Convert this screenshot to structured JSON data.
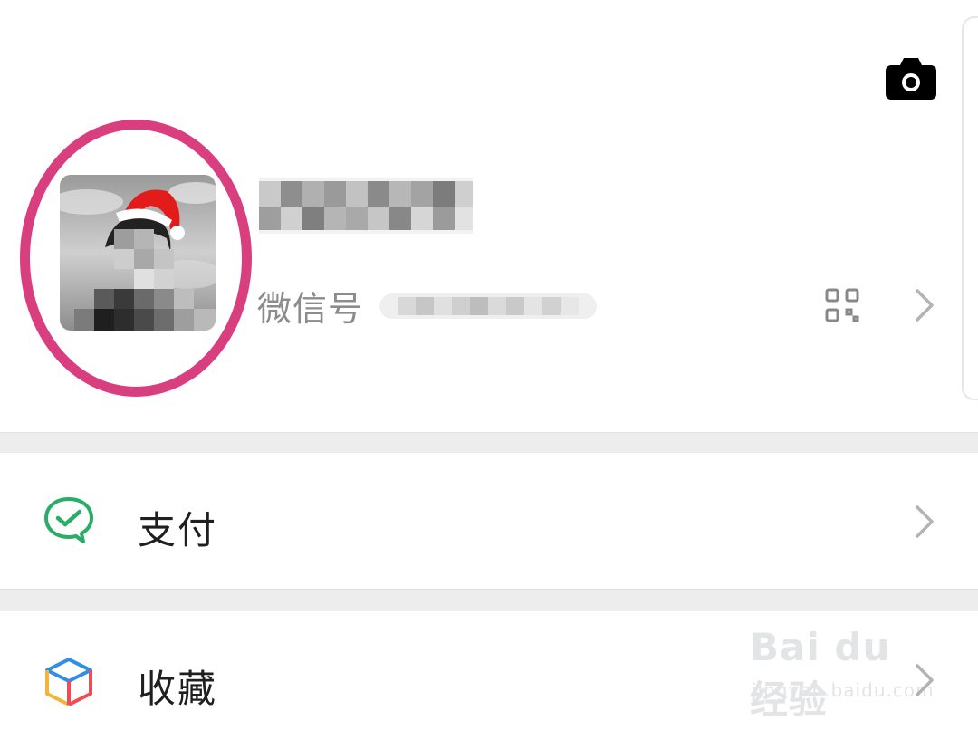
{
  "profile": {
    "wechat_id_label": "微信号"
  },
  "menu": [
    {
      "label": "支付"
    },
    {
      "label": "收藏"
    }
  ],
  "icons": {
    "camera": "camera-icon",
    "qr": "qr-code-icon",
    "chevron": "chevron-right-icon",
    "pay": "pay-check-icon",
    "favorites": "favorites-cube-icon"
  },
  "colors": {
    "highlight": "#d93f7f",
    "pay_green": "#2aae67",
    "separator": "#ededed"
  },
  "watermark": {
    "logo": "Bai du 经验",
    "url": "jingyan.baidu.com"
  }
}
